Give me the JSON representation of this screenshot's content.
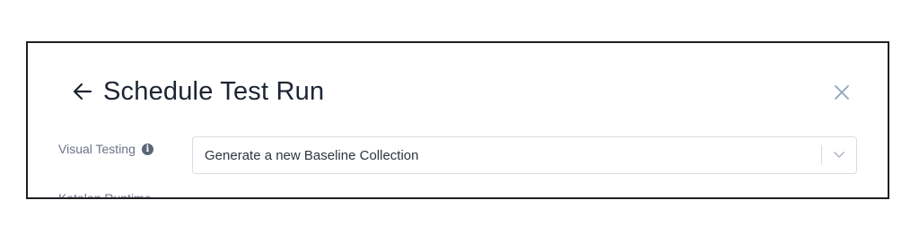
{
  "dialog": {
    "title": "Schedule Test Run",
    "back_icon": "arrow-left-icon",
    "close_icon": "close-icon"
  },
  "visual_testing": {
    "label": "Visual Testing",
    "info_icon": "info-icon",
    "info_glyph": "i",
    "selected_value": "Generate a new Baseline Collection",
    "dropdown_icon": "chevron-down-icon"
  },
  "katalon_runtime": {
    "label": "Katalon Runtime"
  },
  "colors": {
    "title": "#1d2433",
    "label": "#6b7387",
    "border": "#d8dbe2",
    "close": "#8fa3c0"
  }
}
